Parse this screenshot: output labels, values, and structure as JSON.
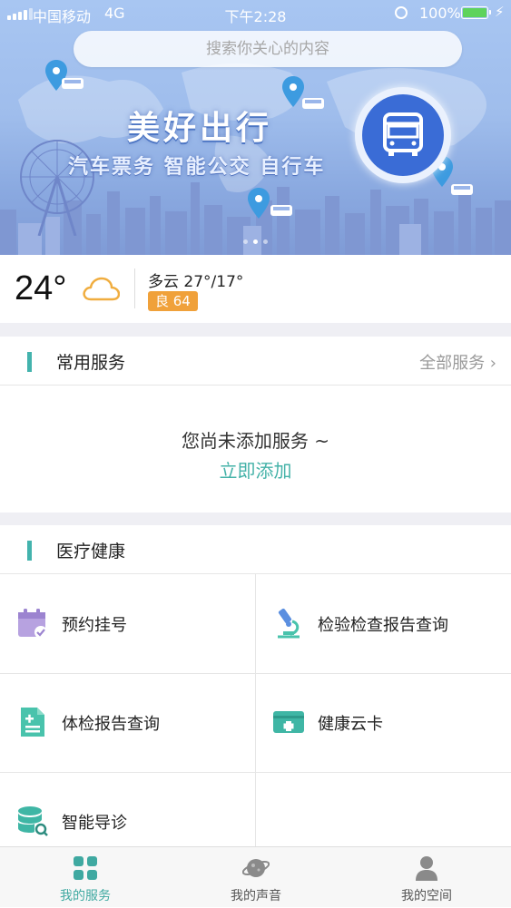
{
  "status_bar": {
    "carrier": "中国移动",
    "network": "4G",
    "time": "下午2:28",
    "battery": "100%"
  },
  "search": {
    "placeholder": "搜索你关心的内容"
  },
  "banner": {
    "title": "美好出行",
    "subtitle": "汽车票务 智能公交 自行车",
    "active_slide": 2,
    "slide_count": 3
  },
  "weather": {
    "temperature": "24°",
    "condition": "多云 27°/17°",
    "aqi": "良 64"
  },
  "common_services": {
    "title": "常用服务",
    "all_link": "全部服务 ›",
    "empty_message": "您尚未添加服务 ~",
    "add_link": "立即添加"
  },
  "medical": {
    "title": "医疗健康",
    "items": [
      {
        "label": "预约挂号",
        "icon": "calendar-check-icon",
        "color": "#a98fd6"
      },
      {
        "label": "检验检查报告查询",
        "icon": "microscope-icon",
        "color": "#5b8fe0"
      },
      {
        "label": "体检报告查询",
        "icon": "medical-report-icon",
        "color": "#49c3ac"
      },
      {
        "label": "健康云卡",
        "icon": "health-card-icon",
        "color": "#3fb6a5"
      },
      {
        "label": "智能导诊",
        "icon": "database-search-icon",
        "color": "#3fb6a5"
      }
    ]
  },
  "tabbar": {
    "tabs": [
      {
        "label": "我的服务",
        "icon": "grid-icon",
        "active": true
      },
      {
        "label": "我的声音",
        "icon": "planet-icon",
        "active": false
      },
      {
        "label": "我的空间",
        "icon": "person-icon",
        "active": false
      }
    ]
  },
  "colors": {
    "accent": "#43b3ad",
    "banner_blue": "#3a6cd6",
    "aqi_orange": "#f0a13a"
  }
}
